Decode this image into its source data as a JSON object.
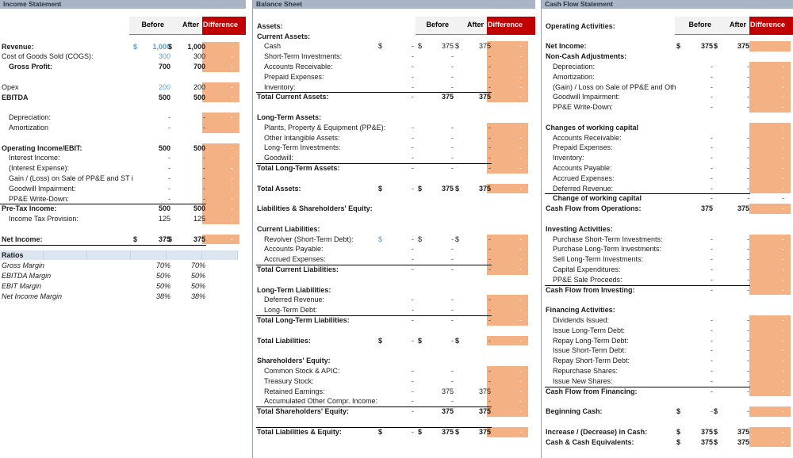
{
  "panels": {
    "income_statement": {
      "title": "Income Statement",
      "columns": [
        "Before",
        "After",
        "Difference"
      ],
      "rows": [
        {
          "label": "Revenue:",
          "bold": true,
          "before": "1,000",
          "after": "1,000",
          "before_cur": "$",
          "after_cur": "$",
          "before_blue": true,
          "diff": "-"
        },
        {
          "label": "Cost of Goods Sold (COGS):",
          "before": "300",
          "after": "300",
          "before_blue": true,
          "diff": "-"
        },
        {
          "label": "Gross Profit:",
          "bold": true,
          "indent": 1,
          "before": "700",
          "after": "700",
          "diff": "-"
        },
        {
          "spacer": true
        },
        {
          "label": "Opex",
          "before": "200",
          "after": "200",
          "before_blue": true,
          "diff": "-"
        },
        {
          "label": "EBITDA",
          "bold": true,
          "before": "500",
          "after": "500",
          "diff": "-"
        },
        {
          "spacer": true
        },
        {
          "label": "Depreciation:",
          "indent": 1,
          "before": "-",
          "after": "-",
          "diff": "-"
        },
        {
          "label": "Amortization",
          "indent": 1,
          "before": "-",
          "after": "-",
          "diff": "-"
        },
        {
          "spacer": true
        },
        {
          "label": "Operating Income/EBIT:",
          "bold": true,
          "before": "500",
          "after": "500",
          "diff": "-"
        },
        {
          "label": "Interest Income:",
          "indent": 1,
          "before": "-",
          "after": "-",
          "diff": "-"
        },
        {
          "label": "(Interest Expense):",
          "indent": 1,
          "before": "-",
          "after": "-",
          "diff": "-"
        },
        {
          "label": "Gain / (Loss) on Sale of PP&E and ST i",
          "indent": 1,
          "before": "-",
          "after": "-",
          "diff": "-"
        },
        {
          "label": "Goodwill Impairment:",
          "indent": 1,
          "before": "-",
          "after": "-",
          "diff": "-"
        },
        {
          "label": "PP&E Write-Down:",
          "indent": 1,
          "before": "-",
          "after": "-",
          "diff": "-",
          "rule_after": true
        },
        {
          "label": "Pre-Tax Income:",
          "bold": true,
          "before": "500",
          "after": "500",
          "diff": "-"
        },
        {
          "label": "Income Tax Provision:",
          "indent": 1,
          "before": "125",
          "after": "125",
          "diff": "-"
        },
        {
          "spacer": true
        },
        {
          "label": "Net Income:",
          "bold": true,
          "before": "375",
          "after": "375",
          "before_cur": "$",
          "after_cur": "$",
          "diff": "-",
          "rule_after": true
        }
      ],
      "ratios": {
        "header": "Ratios",
        "rows": [
          {
            "label": "Gross Margin",
            "before": "70%",
            "after": "70%"
          },
          {
            "label": "EBITDA Margin",
            "before": "50%",
            "after": "50%"
          },
          {
            "label": "EBIT Margin",
            "before": "50%",
            "after": "50%"
          },
          {
            "label": "Net Income Margin",
            "before": "38%",
            "after": "38%"
          }
        ]
      }
    },
    "balance_sheet": {
      "title": "Balance Sheet",
      "columns": [
        "Before",
        "After",
        "Difference"
      ],
      "rows": [
        {
          "spacer": true
        },
        {
          "label": "Assets:",
          "bold": true
        },
        {
          "label": "Current Assets:",
          "bold": true
        },
        {
          "label": "Cash",
          "indent": 1,
          "c0_cur": "$",
          "c0": "-",
          "before_cur": "$",
          "before": "375",
          "after_cur": "$",
          "after": "375",
          "diff": "-"
        },
        {
          "label": "Short-Term Investments:",
          "indent": 1,
          "c0": "-",
          "before": "-",
          "after": "-",
          "diff": "-"
        },
        {
          "label": "Accounts Receivable:",
          "indent": 1,
          "c0": "-",
          "before": "-",
          "after": "-",
          "diff": "-"
        },
        {
          "label": "Prepaid Expenses:",
          "indent": 1,
          "c0": "-",
          "before": "-",
          "after": "-",
          "diff": "-"
        },
        {
          "label": "Inventory:",
          "indent": 1,
          "c0": "-",
          "before": "-",
          "after": "-",
          "diff": "-",
          "rule_after": true
        },
        {
          "label": "Total Current Assets:",
          "bold": true,
          "c0": "-",
          "before": "375",
          "after": "375",
          "diff": "-"
        },
        {
          "spacer": true
        },
        {
          "label": "Long-Term Assets:",
          "bold": true
        },
        {
          "label": "Plants, Property & Equipment (PP&E):",
          "indent": 1,
          "c0": "-",
          "before": "-",
          "after": "-",
          "diff": "-"
        },
        {
          "label": "Other Intangible Assets:",
          "indent": 1,
          "c0": "-",
          "before": "-",
          "after": "-",
          "diff": "-"
        },
        {
          "label": "Long-Term Investments:",
          "indent": 1,
          "c0": "-",
          "before": "-",
          "after": "-",
          "diff": "-"
        },
        {
          "label": "Goodwill:",
          "indent": 1,
          "c0": "-",
          "before": "-",
          "after": "-",
          "diff": "-",
          "rule_after": true
        },
        {
          "label": "Total Long-Term Assets:",
          "bold": true,
          "c0": "-",
          "before": "-",
          "after": "-",
          "diff": "-"
        },
        {
          "spacer": true
        },
        {
          "label": "Total Assets:",
          "bold": true,
          "c0_cur": "$",
          "c0": "-",
          "before_cur": "$",
          "before": "375",
          "after_cur": "$",
          "after": "375",
          "diff": "-"
        },
        {
          "spacer": true
        },
        {
          "label": "Liabilities & Shareholders' Equity:",
          "bold": true
        },
        {
          "spacer": true
        },
        {
          "label": "Current Liabilities:",
          "bold": true
        },
        {
          "label": "Revolver (Short-Term Debt):",
          "indent": 1,
          "c0_cur": "$",
          "c0": "-",
          "c0_blue": true,
          "before_cur": "$",
          "before": "-",
          "after_cur": "$",
          "after": "-",
          "diff": "-"
        },
        {
          "label": "Accounts Payable:",
          "indent": 1,
          "c0": "-",
          "before": "-",
          "after": "-",
          "diff": "-"
        },
        {
          "label": "Accrued Expenses:",
          "indent": 1,
          "c0": "-",
          "before": "-",
          "after": "-",
          "diff": "-",
          "rule_after": true
        },
        {
          "label": "Total Current Liabilities:",
          "bold": true,
          "c0": "-",
          "before": "-",
          "after": "-",
          "diff": "-"
        },
        {
          "spacer": true
        },
        {
          "label": "Long-Term Liabilities:",
          "bold": true
        },
        {
          "label": "Deferred Revenue:",
          "indent": 1,
          "c0": "-",
          "before": "-",
          "after": "-",
          "diff": "-"
        },
        {
          "label": "Long-Term Debt:",
          "indent": 1,
          "c0": "-",
          "before": "-",
          "after": "-",
          "diff": "-",
          "rule_after": true
        },
        {
          "label": "Total Long-Term Liabilities:",
          "bold": true,
          "c0": "-",
          "before": "-",
          "after": "-",
          "diff": "-"
        },
        {
          "spacer": true
        },
        {
          "label": "Total Liabilities:",
          "bold": true,
          "c0_cur": "$",
          "c0": "-",
          "before_cur": "$",
          "before": "-",
          "after_cur": "$",
          "after": "-",
          "diff": "-"
        },
        {
          "spacer": true
        },
        {
          "label": "Shareholders' Equity:",
          "bold": true
        },
        {
          "label": "Common Stock & APIC:",
          "indent": 1,
          "c0": "-",
          "before": "-",
          "after": "-",
          "diff": "-"
        },
        {
          "label": "Treasury Stock:",
          "indent": 1,
          "c0": "-",
          "before": "-",
          "after": "-",
          "diff": "-"
        },
        {
          "label": "Retained Earnings:",
          "indent": 1,
          "c0": "-",
          "before": "375",
          "after": "375",
          "diff": "-"
        },
        {
          "label": "Accumulated Other Compr. Income:",
          "indent": 1,
          "c0": "-",
          "before": "-",
          "after": "-",
          "diff": "-",
          "rule_after": true
        },
        {
          "label": "Total Shareholders' Equity:",
          "bold": true,
          "c0": "-",
          "before": "375",
          "after": "375",
          "diff": "-"
        },
        {
          "spacer": true
        },
        {
          "label": "Total Liabilities & Equity:",
          "bold": true,
          "c0_cur": "$",
          "c0": "-",
          "before_cur": "$",
          "before": "375",
          "after_cur": "$",
          "after": "375",
          "diff": "-",
          "rule_before": true
        }
      ]
    },
    "cash_flow_statement": {
      "title": "Cash Flow Statement",
      "columns": [
        "Before",
        "After",
        "Difference"
      ],
      "rows": [
        {
          "spacer": true
        },
        {
          "label": "Operating Activities:",
          "bold": true
        },
        {
          "spacer": true
        },
        {
          "label": "Net Income:",
          "bold": true,
          "before_cur": "$",
          "before": "375",
          "after_cur": "$",
          "after": "375",
          "diff": ""
        },
        {
          "label": "Non-Cash Adjustments:",
          "bold": true
        },
        {
          "label": "Depreciation:",
          "indent": 1,
          "before": "-",
          "after": "-",
          "diff": "-"
        },
        {
          "label": "Amortization:",
          "indent": 1,
          "before": "-",
          "after": "-",
          "diff": "-"
        },
        {
          "label": "(Gain) / Loss on Sale of PP&E and Oth",
          "indent": 1,
          "before": "-",
          "after": "-",
          "diff": "-"
        },
        {
          "label": "Goodwill Impairment:",
          "indent": 1,
          "before": "-",
          "after": "-",
          "diff": "-"
        },
        {
          "label": "PP&E Write-Down:",
          "indent": 1,
          "before": "-",
          "after": "-",
          "diff": "-"
        },
        {
          "spacer": true
        },
        {
          "label": "Changes of working capital",
          "bold": true,
          "diff": "-"
        },
        {
          "label": "Accounts Receivable:",
          "indent": 1,
          "before": "-",
          "after": "-",
          "diff": "-"
        },
        {
          "label": "Prepaid Expenses:",
          "indent": 1,
          "before": "-",
          "after": "-",
          "diff": "-"
        },
        {
          "label": "Inventory:",
          "indent": 1,
          "before": "-",
          "after": "-",
          "diff": "-"
        },
        {
          "label": "Accounts Payable:",
          "indent": 1,
          "before": "-",
          "after": "-",
          "diff": "-"
        },
        {
          "label": "Accrued Expenses:",
          "indent": 1,
          "before": "-",
          "after": "-",
          "diff": "-"
        },
        {
          "label": "Deferred Revenue:",
          "indent": 1,
          "before": "-",
          "after": "-",
          "diff": "-",
          "rule_after": true
        },
        {
          "label": "Change of working capital",
          "bold": true,
          "indent": 1,
          "before": "-",
          "after": "-",
          "diff_plain": "-"
        },
        {
          "label": "Cash Flow from Operations:",
          "bold": true,
          "before": "375",
          "after": "375",
          "diff": "-"
        },
        {
          "spacer": true
        },
        {
          "label": "Investing Activities:",
          "bold": true
        },
        {
          "label": "Purchase Short-Term Investments:",
          "indent": 1,
          "before": "-",
          "after": "-",
          "diff": "-"
        },
        {
          "label": "Purchase Long-Term Investments:",
          "indent": 1,
          "before": "-",
          "after": "-",
          "diff": "-"
        },
        {
          "label": "Sell Long-Term Investments:",
          "indent": 1,
          "before": "-",
          "after": "-",
          "diff": "-"
        },
        {
          "label": "Capital Expenditures:",
          "indent": 1,
          "before": "-",
          "after": "-",
          "diff": "-"
        },
        {
          "label": "PP&E Sale Proceeds:",
          "indent": 1,
          "before": "-",
          "after": "-",
          "diff": "-",
          "rule_after": true
        },
        {
          "label": "Cash Flow from Investing:",
          "bold": true,
          "before": "-",
          "after": "-",
          "diff": "-"
        },
        {
          "spacer": true
        },
        {
          "label": "Financing Activities:",
          "bold": true
        },
        {
          "label": "Dividends Issued:",
          "indent": 1,
          "before": "-",
          "after": "-",
          "diff": "-"
        },
        {
          "label": "Issue Long-Term Debt:",
          "indent": 1,
          "before": "-",
          "after": "-",
          "diff": "-"
        },
        {
          "label": "Repay Long-Term Debt:",
          "indent": 1,
          "before": "-",
          "after": "-",
          "diff": "-"
        },
        {
          "label": "Issue Short-Term Debt:",
          "indent": 1,
          "before": "-",
          "after": "-",
          "diff": "-"
        },
        {
          "label": "Repay Short-Term Debt:",
          "indent": 1,
          "before": "-",
          "after": "-",
          "diff": "-"
        },
        {
          "label": "Repurchase Shares:",
          "indent": 1,
          "before": "-",
          "after": "-",
          "diff": "-"
        },
        {
          "label": "Issue New Shares:",
          "indent": 1,
          "before": "-",
          "after": "-",
          "diff": "-",
          "rule_after": true
        },
        {
          "label": "Cash Flow from Financing:",
          "bold": true,
          "before": "-",
          "after": "-",
          "diff": "-"
        },
        {
          "spacer": true
        },
        {
          "label": "Beginning Cash:",
          "bold": true,
          "before_cur": "$",
          "before": "-",
          "after_cur": "$",
          "after": "-",
          "diff": "-"
        },
        {
          "spacer": true
        },
        {
          "label": "Increase / (Decrease) in Cash:",
          "bold": true,
          "before_cur": "$",
          "before": "375",
          "after_cur": "$",
          "after": "375",
          "diff": "-"
        },
        {
          "label": "Cash & Cash Equivalents:",
          "bold": true,
          "before_cur": "$",
          "before": "375",
          "after_cur": "$",
          "after": "375",
          "diff": "-"
        }
      ]
    }
  },
  "colors": {
    "title_bar": "#a9b4c4",
    "difference_header": "#c00000",
    "difference_fill": "#f4b183",
    "header_fill": "#f2f2f2",
    "ratios_fill": "#dce6f1",
    "input_blue": "#5b9bd5"
  }
}
